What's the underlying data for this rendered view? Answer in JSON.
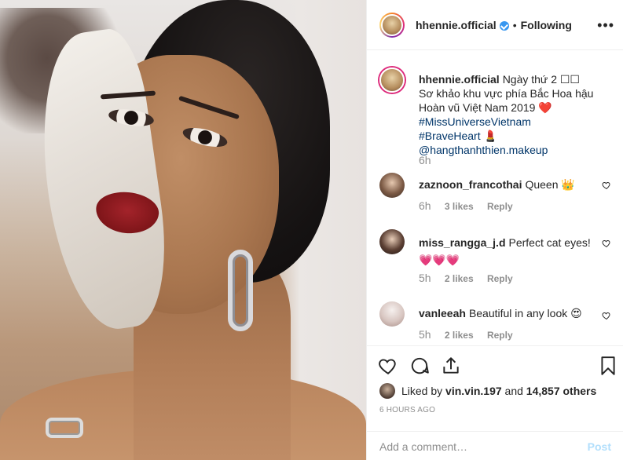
{
  "post": {
    "username": "hhennie.official",
    "follow_status": "Following",
    "separator": "•",
    "more": "•••"
  },
  "caption": {
    "username": "hhennie.official",
    "text": "Ngày thứ 2 ☐☐ Sơ khảo khu vực phía Bắc Hoa hậu Hoàn vũ Việt Nam 2019 ❤️",
    "hashtags": "#MissUniverseVietnam #BraveHeart 💄",
    "mention": "@hangthanhthien.makeup",
    "time": "6h"
  },
  "comments": [
    {
      "username": "zaznoon_francothai",
      "text": "Queen 👑",
      "time": "6h",
      "likes": "3 likes",
      "reply": "Reply"
    },
    {
      "username": "miss_rangga_j.d",
      "text": "Perfect cat eyes! 💗💗💗",
      "time": "5h",
      "likes": "2 likes",
      "reply": "Reply"
    },
    {
      "username": "vanleeah",
      "text": "Beautiful in any look 😍",
      "time": "5h",
      "likes": "2 likes",
      "reply": "Reply"
    }
  ],
  "likes": {
    "prefix": "Liked by",
    "user": "vin.vin.197",
    "and": "and",
    "others": "14,857 others"
  },
  "timestamp": "6 HOURS AGO",
  "add_comment": {
    "placeholder": "Add a comment…",
    "post_label": "Post"
  },
  "icons": [
    "heart-icon",
    "comment-icon",
    "share-icon",
    "bookmark-icon",
    "verified-badge-icon",
    "more-options-icon"
  ],
  "colors": {
    "link": "#003569",
    "verified": "#3897f0",
    "muted": "#8e8e8e",
    "post_disabled": "#b2dffc"
  }
}
